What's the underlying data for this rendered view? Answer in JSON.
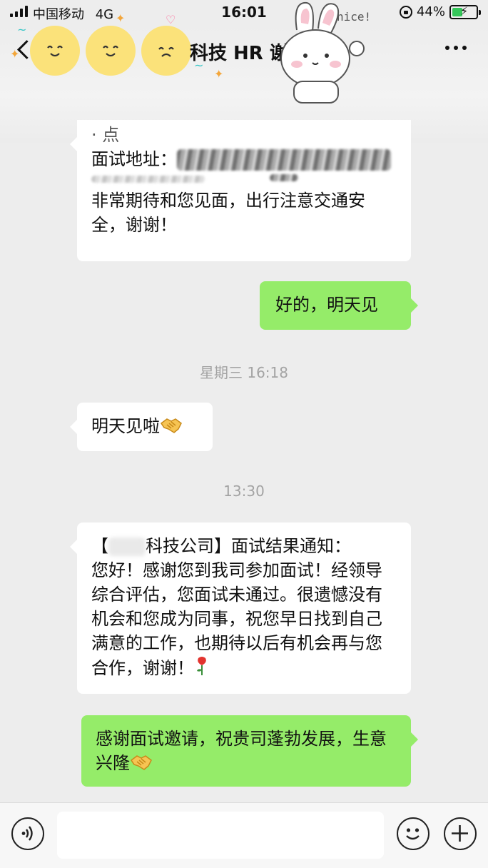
{
  "status_bar": {
    "carrier": "中国移动",
    "network": "4G",
    "time": "16:01",
    "battery": "44%",
    "battery_level": 0.44
  },
  "nav": {
    "title": "科技 HR 谢",
    "sticker_text": "nice!"
  },
  "messages": {
    "m1": {
      "partial_line": "· 点",
      "address_label": "面试地址：",
      "text": "非常期待和您见面，出行注意交通安全，谢谢！"
    },
    "m2": {
      "text": "好的，明天见"
    },
    "ts1": "星期三 16:18",
    "m3": {
      "text": "明天见啦"
    },
    "ts2": "13:30",
    "m4": {
      "open_bracket": "【",
      "company_suffix": "科技公司】面试结果通知：",
      "body": "您好！感谢您到我司参加面试！经领导综合评估，您面试未通过。很遗憾没有机会和您成为同事，祝您早日找到自己满意的工作，也期待以后有机会再与您合作，谢谢！"
    },
    "m5": {
      "text": "感谢面试邀请，祝贵司蓬勃发展，生意兴隆"
    }
  },
  "input": {
    "value": ""
  },
  "colors": {
    "background": "#ededed",
    "outgoing_bubble": "#95ec69",
    "incoming_bubble": "#ffffff",
    "timestamp": "#a3a3a3"
  },
  "icons": {
    "handshake": "handshake-icon",
    "rose": "rose-icon",
    "voice": "voice-icon",
    "emoji": "emoji-icon",
    "plus": "plus-icon"
  }
}
